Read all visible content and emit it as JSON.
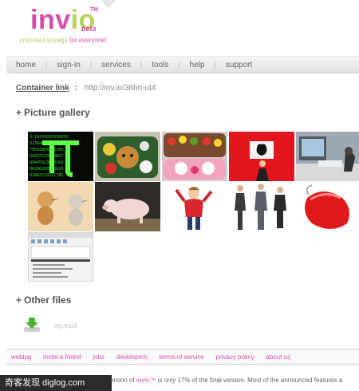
{
  "header": {
    "logo_part1": "inv",
    "logo_part2": "io",
    "logo_tm": "TM",
    "logo_beta": "beta",
    "tagline_pre": "unlimited storage ",
    "tagline_pink": "for everyone!"
  },
  "nav": {
    "items": [
      "home",
      "sign-in",
      "services",
      "tools",
      "help",
      "support"
    ]
  },
  "container": {
    "label": "Container link",
    "colon": ":",
    "url": "http://inv.io/36hn-ut4"
  },
  "gallery": {
    "title": "Picture gallery",
    "plus": "+"
  },
  "files": {
    "title": "Other files",
    "plus": "+",
    "items": [
      "my.mp3"
    ]
  },
  "footer": {
    "links": [
      "weblog",
      "invite a friend",
      "jobs",
      "developers",
      "terms of service",
      "privacy policy",
      "about us"
    ]
  },
  "note": {
    "pre": "ersion of ",
    "brand": "invio™",
    "post": " is only 17% of the final version. Most of the announced features a"
  },
  "watermark": "奇客发现 diglog.com"
}
